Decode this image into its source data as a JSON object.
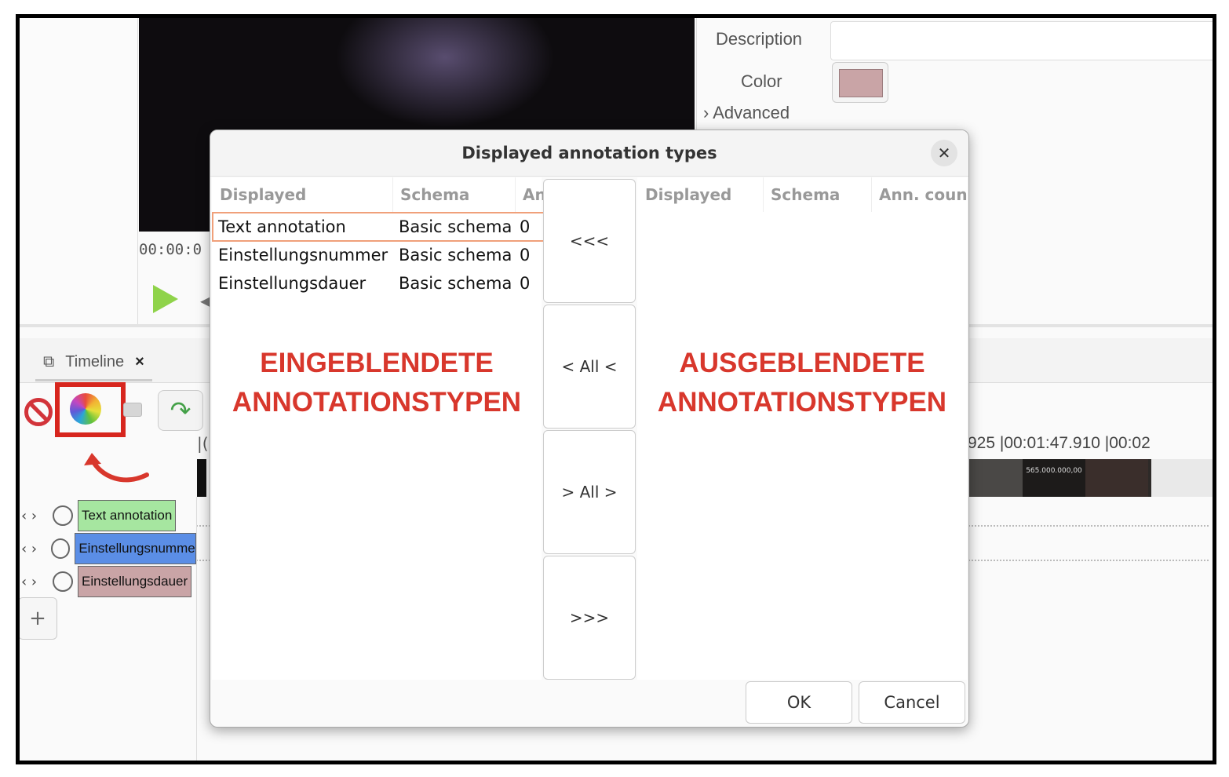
{
  "player": {
    "timecode": "00:00:0"
  },
  "properties": {
    "description_label": "Description",
    "color_label": "Color",
    "advanced_label": "› Advanced",
    "color_value": "#c9a4a6"
  },
  "timeline": {
    "tab_label": "Timeline",
    "tab_close": "×",
    "ruler_text": "925   |00:01:47.910   |00:02",
    "left_tick": "|(",
    "thumb_text": "565.000.000,00",
    "add_label": "+",
    "tracks": [
      {
        "arrows": "‹ ›",
        "label": "Text annotation",
        "color": "#a6e6a0"
      },
      {
        "arrows": "‹ ›",
        "label": "Einstellungsnummer",
        "color": "#5b8ee6"
      },
      {
        "arrows": "‹ ›",
        "label": "Einstellungsdauer",
        "color": "#c9a4a6"
      }
    ]
  },
  "dialog": {
    "title": "Displayed annotation types",
    "close": "✕",
    "left_headers": [
      "Displayed",
      "Schema",
      "An"
    ],
    "right_headers": [
      "Displayed",
      "Schema",
      "Ann. coun"
    ],
    "rows": [
      {
        "name": "Text annotation",
        "schema": "Basic schema",
        "count": "0"
      },
      {
        "name": "Einstellungsnummer",
        "schema": "Basic schema",
        "count": "0"
      },
      {
        "name": "Einstellungsdauer",
        "schema": "Basic schema",
        "count": "0"
      }
    ],
    "buttons": {
      "move_left": "<<<",
      "all_left": "< All <",
      "all_right": "> All >",
      "move_right": ">>>",
      "ok": "OK",
      "cancel": "Cancel"
    }
  },
  "overlays": {
    "left": [
      "EINGEBLENDETE",
      "ANNOTATIONSTYPEN"
    ],
    "right": [
      "AUSGEBLENDETE",
      "ANNOTATIONSTYPEN"
    ]
  },
  "colors": {
    "annotation_red": "#d8372c",
    "highlight_box": "#d7261e"
  }
}
